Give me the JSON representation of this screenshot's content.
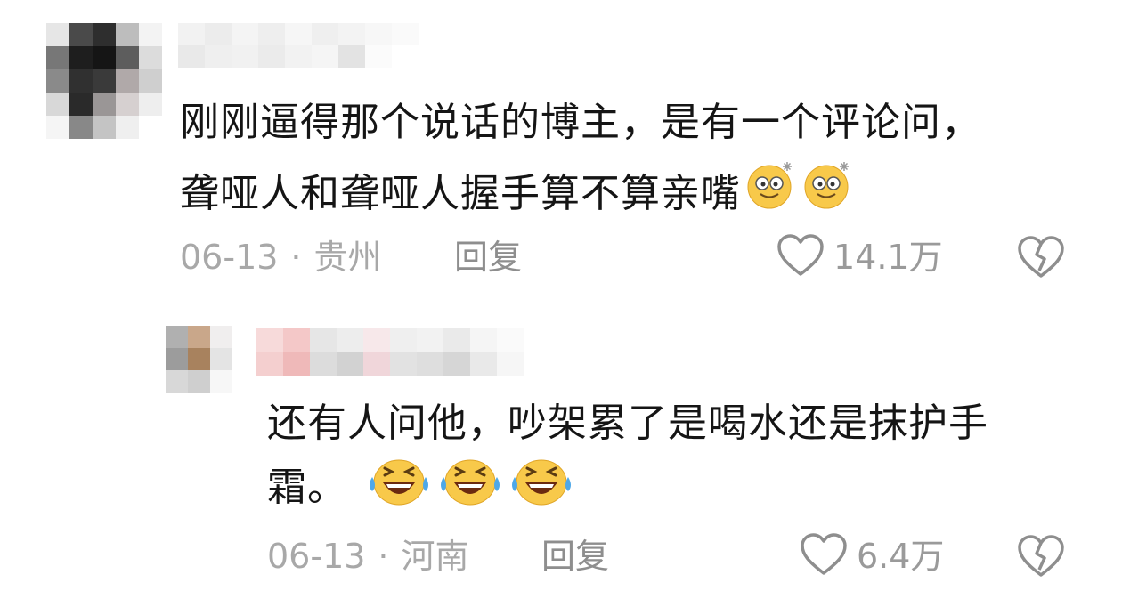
{
  "comments": [
    {
      "text_line1": "刚刚逼得那个说话的博主，是有一个评论问，",
      "text_line2": "聋哑人和聋哑人握手算不算亲嘴",
      "emojis": [
        "dizzy-face-icon",
        "dizzy-face-icon"
      ],
      "date": "06-13",
      "separator": "·",
      "location": "贵州",
      "reply_label": "回复",
      "likes": "14.1万"
    },
    {
      "text_line1": "还有人问他，吵架累了是喝水还是抹护手",
      "text_line2": "霜。",
      "emojis": [
        "laughing-crying-icon",
        "laughing-crying-icon",
        "laughing-crying-icon"
      ],
      "date": "06-13",
      "separator": "·",
      "location": "河南",
      "reply_label": "回复",
      "likes": "6.4万"
    }
  ],
  "colors": {
    "text": "#151515",
    "meta": "#a8a8a8",
    "icon": "#8e8e8e",
    "emoji_face": "#f8c94a"
  }
}
